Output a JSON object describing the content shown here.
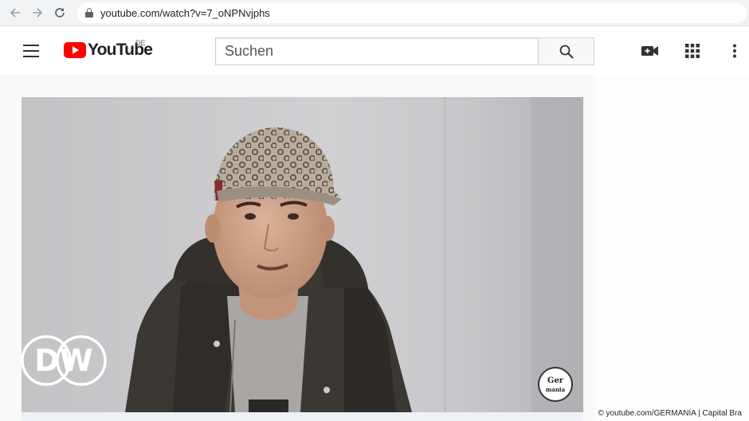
{
  "browser": {
    "url": "youtube.com/watch?v=7_oNPNvjphs"
  },
  "youtube": {
    "logo_text": "YouTube",
    "region": "DE",
    "search_placeholder": "Suchen"
  },
  "video": {
    "watermark_text": "Ger mania"
  },
  "overlay": {
    "logo": "DW",
    "credit": "© youtube.com/GERMANIA | Capital Bra"
  },
  "colors": {
    "youtube_red": "#ff0000",
    "dw_logo": "#ffffff",
    "browser_bar": "#f1f3f4"
  },
  "icons": [
    "back-arrow-icon",
    "forward-arrow-icon",
    "reload-icon",
    "lock-icon",
    "menu-icon",
    "search-icon",
    "create-video-icon",
    "apps-grid-icon",
    "more-vert-icon"
  ]
}
